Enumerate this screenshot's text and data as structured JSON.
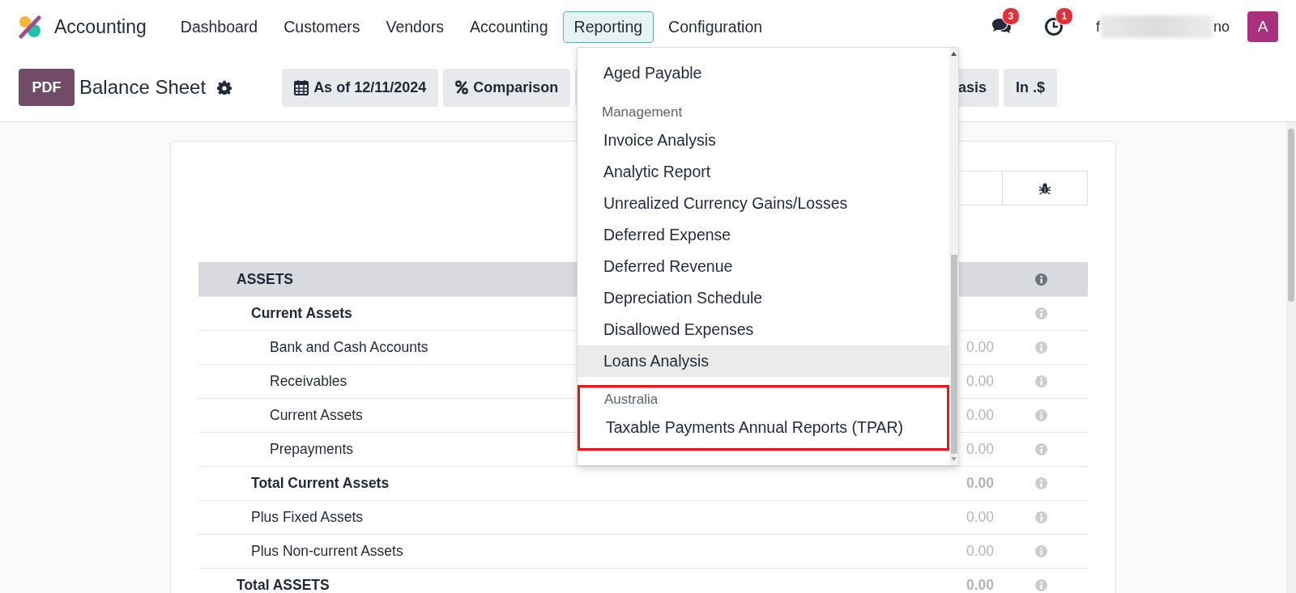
{
  "app": {
    "name": "Accounting"
  },
  "menu": [
    {
      "label": "Dashboard",
      "selected": false
    },
    {
      "label": "Customers",
      "selected": false
    },
    {
      "label": "Vendors",
      "selected": false
    },
    {
      "label": "Accounting",
      "selected": false
    },
    {
      "label": "Reporting",
      "selected": true
    },
    {
      "label": "Configuration",
      "selected": false
    }
  ],
  "systray": {
    "messages_count": "3",
    "activities_count": "1",
    "user_name_start": "f",
    "user_name_end": "no",
    "avatar_letter": "A"
  },
  "control_panel": {
    "pdf_button": "PDF",
    "title": "Balance Sheet",
    "filters": [
      {
        "kind": "date",
        "label": "As of 12/11/2024"
      },
      {
        "kind": "comparison",
        "label": "Comparison"
      },
      {
        "kind": "basis",
        "label": "asis"
      },
      {
        "kind": "currency",
        "label": "In .$"
      }
    ]
  },
  "reporting_menu": {
    "sections": [
      {
        "outlined": false,
        "items": [
          {
            "label": "Aged Payable",
            "selected": false
          }
        ]
      },
      {
        "header": "Management",
        "outlined": false,
        "items": [
          {
            "label": "Invoice Analysis",
            "selected": false
          },
          {
            "label": "Analytic Report",
            "selected": false
          },
          {
            "label": "Unrealized Currency Gains/Losses",
            "selected": false
          },
          {
            "label": "Deferred Expense",
            "selected": false
          },
          {
            "label": "Deferred Revenue",
            "selected": false
          },
          {
            "label": "Depreciation Schedule",
            "selected": false
          },
          {
            "label": "Disallowed Expenses",
            "selected": false
          },
          {
            "label": "Loans Analysis",
            "selected": true
          }
        ]
      },
      {
        "header": "Australia",
        "outlined": true,
        "items": [
          {
            "label": "Taxable Payments Annual Reports (TPAR)",
            "selected": false
          }
        ]
      }
    ]
  },
  "report": {
    "rows": [
      {
        "kind": "group",
        "label": "ASSETS",
        "children": [
          {
            "kind": "section",
            "label": "Current Assets",
            "children": [
              {
                "kind": "line",
                "label": "Bank and Cash Accounts",
                "value": "0.00"
              },
              {
                "kind": "line",
                "label": "Receivables",
                "value": "0.00"
              },
              {
                "kind": "line",
                "label": "Current Assets",
                "value": "0.00"
              },
              {
                "kind": "line",
                "label": "Prepayments",
                "value": "0.00"
              }
            ]
          },
          {
            "kind": "total",
            "label": "Total Current Assets",
            "value": "0.00"
          },
          {
            "kind": "line",
            "label": "Plus Fixed Assets",
            "value": "0.00"
          },
          {
            "kind": "line",
            "label": "Plus Non-current Assets",
            "value": "0.00"
          }
        ]
      },
      {
        "kind": "total",
        "label": "Total ASSETS",
        "value": "0.00"
      }
    ]
  }
}
